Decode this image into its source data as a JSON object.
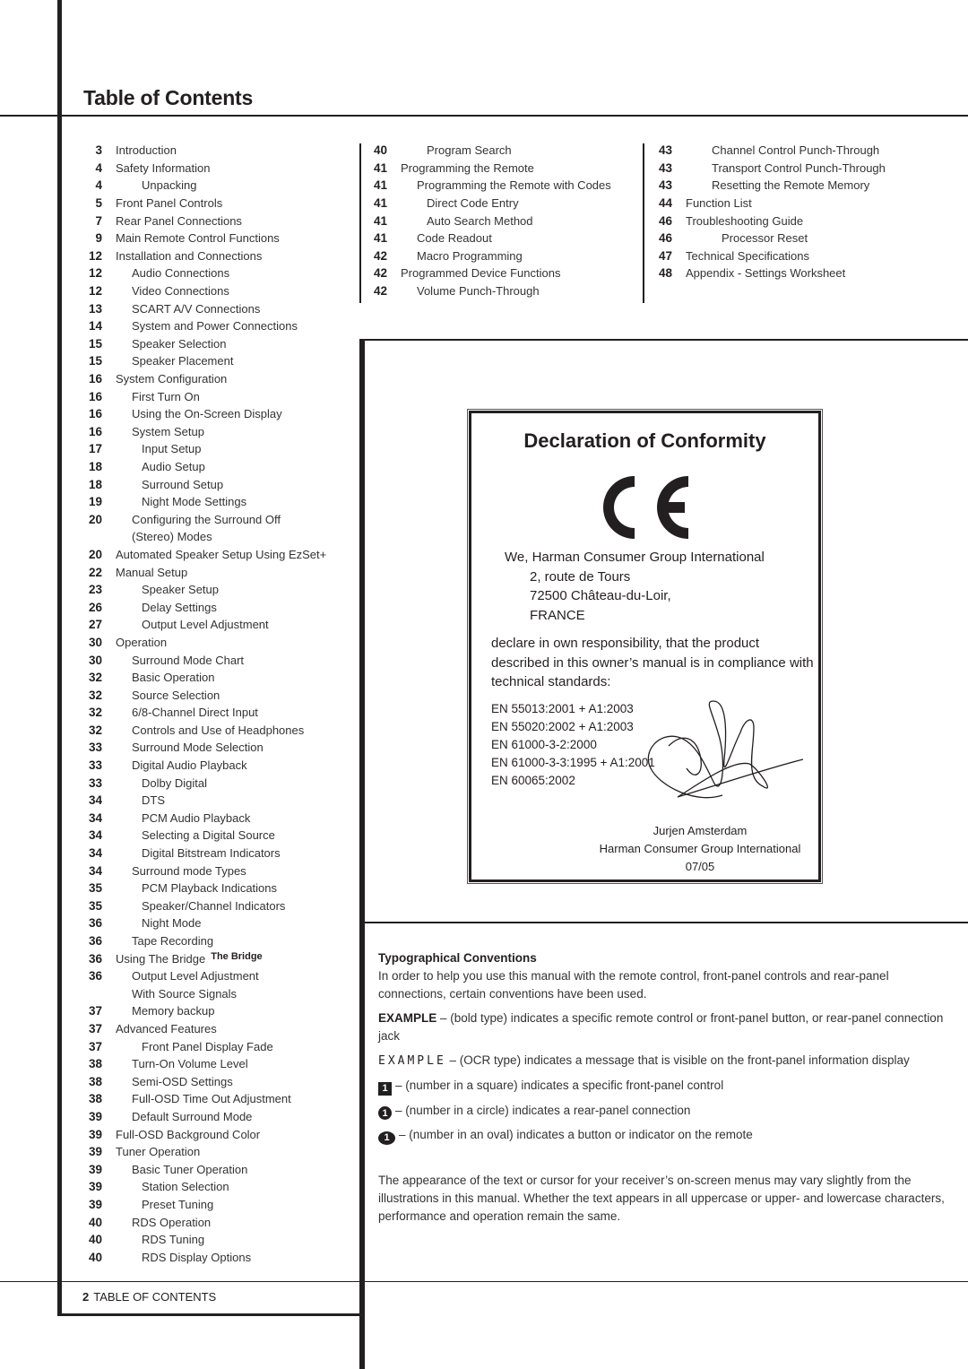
{
  "page": {
    "title": "Table of Contents",
    "footer_page_number": "2",
    "footer_label": "TABLE OF CONTENTS"
  },
  "toc": {
    "column1": [
      {
        "page": "3",
        "label": "Introduction",
        "level": 0
      },
      {
        "page": "4",
        "label": "Safety Information",
        "level": 0
      },
      {
        "page": "4",
        "label": "Unpacking",
        "level": 2
      },
      {
        "page": "5",
        "label": "Front Panel Controls",
        "level": 0
      },
      {
        "page": "7",
        "label": "Rear Panel Connections",
        "level": 0
      },
      {
        "page": "9",
        "label": "Main Remote Control Functions",
        "level": 0
      },
      {
        "page": "12",
        "label": "Installation and Connections",
        "level": 0
      },
      {
        "page": "12",
        "label": "Audio Connections",
        "level": 1
      },
      {
        "page": "12",
        "label": "Video Connections",
        "level": 1
      },
      {
        "page": "13",
        "label": "SCART A/V Connections",
        "level": 1
      },
      {
        "page": "14",
        "label": "System and Power Connections",
        "level": 1
      },
      {
        "page": "15",
        "label": "Speaker Selection",
        "level": 1
      },
      {
        "page": "15",
        "label": "Speaker Placement",
        "level": 1
      },
      {
        "page": "16",
        "label": "System Configuration",
        "level": 0
      },
      {
        "page": "16",
        "label": "First Turn On",
        "level": 1
      },
      {
        "page": "16",
        "label": "Using the On-Screen Display",
        "level": 1
      },
      {
        "page": "16",
        "label": "System Setup",
        "level": 1
      },
      {
        "page": "17",
        "label": "Input Setup",
        "level": 2
      },
      {
        "page": "18",
        "label": "Audio Setup",
        "level": 2
      },
      {
        "page": "18",
        "label": "Surround Setup",
        "level": 2
      },
      {
        "page": "19",
        "label": "Night Mode Settings",
        "level": 2
      },
      {
        "page": "20",
        "label": "Configuring the Surround Off",
        "level": 1
      },
      {
        "page": "",
        "label": "(Stereo) Modes",
        "level": 1
      },
      {
        "page": "20",
        "label": "Automated Speaker Setup Using EzSet+",
        "level": 0
      },
      {
        "page": "22",
        "label": "Manual Setup",
        "level": 0
      },
      {
        "page": "23",
        "label": "Speaker Setup",
        "level": 2
      },
      {
        "page": "26",
        "label": "Delay Settings",
        "level": 2
      },
      {
        "page": "27",
        "label": "Output Level Adjustment",
        "level": 2
      },
      {
        "page": "30",
        "label": "Operation",
        "level": 0
      },
      {
        "page": "30",
        "label": "Surround Mode Chart",
        "level": 1
      },
      {
        "page": "32",
        "label": "Basic Operation",
        "level": 1
      },
      {
        "page": "32",
        "label": "Source Selection",
        "level": 1
      },
      {
        "page": "32",
        "label": "6/8-Channel Direct Input",
        "level": 1
      },
      {
        "page": "32",
        "label": "Controls and Use of Headphones",
        "level": 1
      },
      {
        "page": "33",
        "label": "Surround Mode Selection",
        "level": 1
      },
      {
        "page": "33",
        "label": "Digital Audio Playback",
        "level": 1
      },
      {
        "page": "33",
        "label": "Dolby Digital",
        "level": 2
      },
      {
        "page": "34",
        "label": "DTS",
        "level": 2
      },
      {
        "page": "34",
        "label": "PCM Audio Playback",
        "level": 2
      },
      {
        "page": "34",
        "label": "Selecting a Digital Source",
        "level": 2
      },
      {
        "page": "34",
        "label": "Digital Bitstream Indicators",
        "level": 2
      },
      {
        "page": "34",
        "label": "Surround mode Types",
        "level": 1
      },
      {
        "page": "35",
        "label": "PCM Playback Indications",
        "level": 2
      },
      {
        "page": "35",
        "label": "Speaker/Channel Indicators",
        "level": 2
      },
      {
        "page": "36",
        "label": "Night Mode",
        "level": 2
      },
      {
        "page": "36",
        "label": "Tape Recording",
        "level": 1
      },
      {
        "page": "36",
        "label": "Using The Bridge",
        "level": 0,
        "logo": "The Bridge"
      },
      {
        "page": "36",
        "label": "Output Level Adjustment",
        "level": 1
      },
      {
        "page": "",
        "label": "With Source Signals",
        "level": 1
      },
      {
        "page": "37",
        "label": "Memory backup",
        "level": 1
      },
      {
        "page": "37",
        "label": "Advanced Features",
        "level": 0
      },
      {
        "page": "37",
        "label": "Front Panel Display Fade",
        "level": 2
      },
      {
        "page": "38",
        "label": "Turn-On Volume Level",
        "level": 1
      },
      {
        "page": "38",
        "label": "Semi-OSD Settings",
        "level": 1
      },
      {
        "page": "38",
        "label": "Full-OSD Time Out Adjustment",
        "level": 1
      },
      {
        "page": "39",
        "label": "Default Surround Mode",
        "level": 1
      },
      {
        "page": "39",
        "label": "Full-OSD Background Color",
        "level": 0
      },
      {
        "page": "39",
        "label": "Tuner Operation",
        "level": 0
      },
      {
        "page": "39",
        "label": "Basic Tuner Operation",
        "level": 1
      },
      {
        "page": "39",
        "label": "Station Selection",
        "level": 2
      },
      {
        "page": "39",
        "label": "Preset Tuning",
        "level": 2
      },
      {
        "page": "40",
        "label": "RDS Operation",
        "level": 1
      },
      {
        "page": "40",
        "label": "RDS Tuning",
        "level": 2
      },
      {
        "page": "40",
        "label": "RDS Display Options",
        "level": 2
      }
    ],
    "column2": [
      {
        "page": "40",
        "label": "Program Search",
        "level": 2
      },
      {
        "page": "41",
        "label": "Programming the Remote",
        "level": 0
      },
      {
        "page": "41",
        "label": "Programming the Remote with Codes",
        "level": 1
      },
      {
        "page": "41",
        "label": "Direct Code Entry",
        "level": 2
      },
      {
        "page": "41",
        "label": "Auto Search Method",
        "level": 2
      },
      {
        "page": "41",
        "label": "Code Readout",
        "level": 1
      },
      {
        "page": "42",
        "label": "Macro Programming",
        "level": 1
      },
      {
        "page": "42",
        "label": "Programmed Device Functions",
        "level": 0
      },
      {
        "page": "42",
        "label": "Volume Punch-Through",
        "level": 1
      }
    ],
    "column3": [
      {
        "page": "43",
        "label": "Channel Control Punch-Through",
        "level": 2
      },
      {
        "page": "43",
        "label": "Transport Control Punch-Through",
        "level": 2
      },
      {
        "page": "43",
        "label": "Resetting the Remote Memory",
        "level": 2
      },
      {
        "page": "44",
        "label": "Function List",
        "level": 0
      },
      {
        "page": "46",
        "label": "Troubleshooting Guide",
        "level": 0
      },
      {
        "page": "46",
        "label": "Processor Reset",
        "level": 3
      },
      {
        "page": "47",
        "label": "Technical Specifications",
        "level": 0
      },
      {
        "page": "48",
        "label": "Appendix - Settings Worksheet",
        "level": 0
      }
    ]
  },
  "declaration": {
    "title": "Declaration of Conformity",
    "mark": "CE",
    "address_lead": "We, Harman Consumer Group International",
    "address_lines": [
      "2, route de Tours",
      "72500 Château-du-Loir,",
      "FRANCE"
    ],
    "statement": "declare in own responsibility, that the product described in this owner’s manual is in compliance with technical standards:",
    "standards": [
      "EN 55013:2001 + A1:2003",
      "EN 55020:2002 + A1:2003",
      "EN 61000-3-2:2000",
      "EN 61000-3-3:1995 + A1:2001",
      "EN 60065:2002"
    ],
    "signer_name": "Jurjen Amsterdam",
    "signer_company": "Harman Consumer Group International",
    "date": "07/05"
  },
  "conventions": {
    "heading": "Typographical Conventions",
    "intro": "In order to help you use this manual with the remote control, front-panel controls and rear-panel connections, certain conventions have been used.",
    "bold_example": "EXAMPLE",
    "bold_desc": " – (bold type) indicates a specific remote control or front-panel button, or rear-panel connection jack",
    "ocr_example": "EXAMPLE",
    "ocr_desc": " – (OCR type) indicates a message that is visible on the front-panel information display",
    "square_symbol": "1",
    "square_desc": "–  (number in a square) indicates a specific front-panel control",
    "circle_symbol": "1",
    "circle_desc": "–  (number in a circle) indicates a rear-panel connection",
    "oval_symbol": "1",
    "oval_desc": "– (number in an oval) indicates a button or indicator on the remote",
    "note": "The appearance of the text or cursor for your receiver’s on-screen menus may vary slightly from the illustrations in this manual. Whether the text appears in all uppercase or upper- and lowercase characters, performance and operation remain the same."
  }
}
